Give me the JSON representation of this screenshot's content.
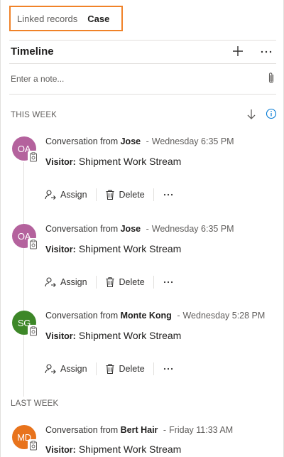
{
  "linked_records": {
    "label": "Linked records",
    "active": "Case"
  },
  "timeline": {
    "title": "Timeline",
    "note_placeholder": "Enter a note...",
    "more": "···"
  },
  "sections": {
    "this_week": "THIS WEEK",
    "last_week": "LAST WEEK"
  },
  "records": [
    {
      "initials": "OA",
      "avatar_color": "#b4629d",
      "prefix": "Conversation from",
      "who": "Jose",
      "sep": "-",
      "when": "Wednesday 6:35 PM",
      "visitor_label": "Visitor:",
      "visitor_value": "Shipment Work Stream",
      "assign": "Assign",
      "delete": "Delete",
      "more": "···"
    },
    {
      "initials": "OA",
      "avatar_color": "#b4629d",
      "prefix": "Conversation from",
      "who": "Jose",
      "sep": "-",
      "when": "Wednesday 6:35 PM",
      "visitor_label": "Visitor:",
      "visitor_value": "Shipment Work Stream",
      "assign": "Assign",
      "delete": "Delete",
      "more": "···"
    },
    {
      "initials": "SG",
      "avatar_color": "#3d8728",
      "prefix": "Conversation from",
      "who": "Monte Kong",
      "sep": "-",
      "when": "Wednesday 5:28 PM",
      "visitor_label": "Visitor:",
      "visitor_value": "Shipment Work Stream",
      "assign": "Assign",
      "delete": "Delete",
      "more": "···"
    },
    {
      "initials": "MD",
      "avatar_color": "#e8731c",
      "prefix": "Conversation from",
      "who": "Bert Hair",
      "sep": "-",
      "when": "Friday 11:33 AM",
      "visitor_label": "Visitor:",
      "visitor_value": "Shipment Work Stream"
    }
  ]
}
